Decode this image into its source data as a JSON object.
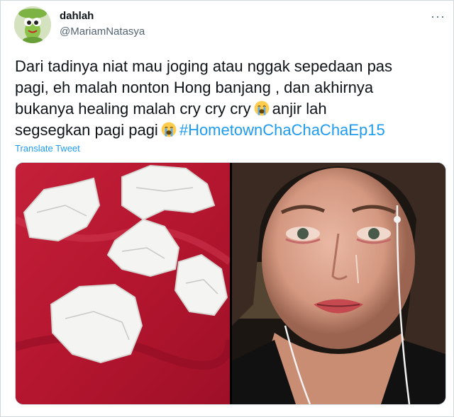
{
  "tweet": {
    "display_name": "dahlah",
    "handle": "@MariamNatasya",
    "more_icon": "more-horizontal-icon",
    "text": {
      "line1": "Dari tadinya niat mau joging atau nggak sepedaan pas",
      "line2": "pagi, eh malah nonton Hong banjang , dan akhirnya",
      "line3a": "bukanya healing malah cry cry cry",
      "line3b": "anjir lah",
      "line4a": "segsegkan pagi pagi",
      "hashtag": "#HometownChaChaChaEp15"
    },
    "translate_label": "Translate Tweet",
    "media": {
      "left_photo": "crumpled-tissues-on-red-cloth",
      "right_photo": "crying-woman-with-earphones"
    }
  },
  "colors": {
    "link": "#1d9bf0",
    "text": "#0f1419",
    "secondary": "#536471",
    "border": "#cfd9de"
  }
}
